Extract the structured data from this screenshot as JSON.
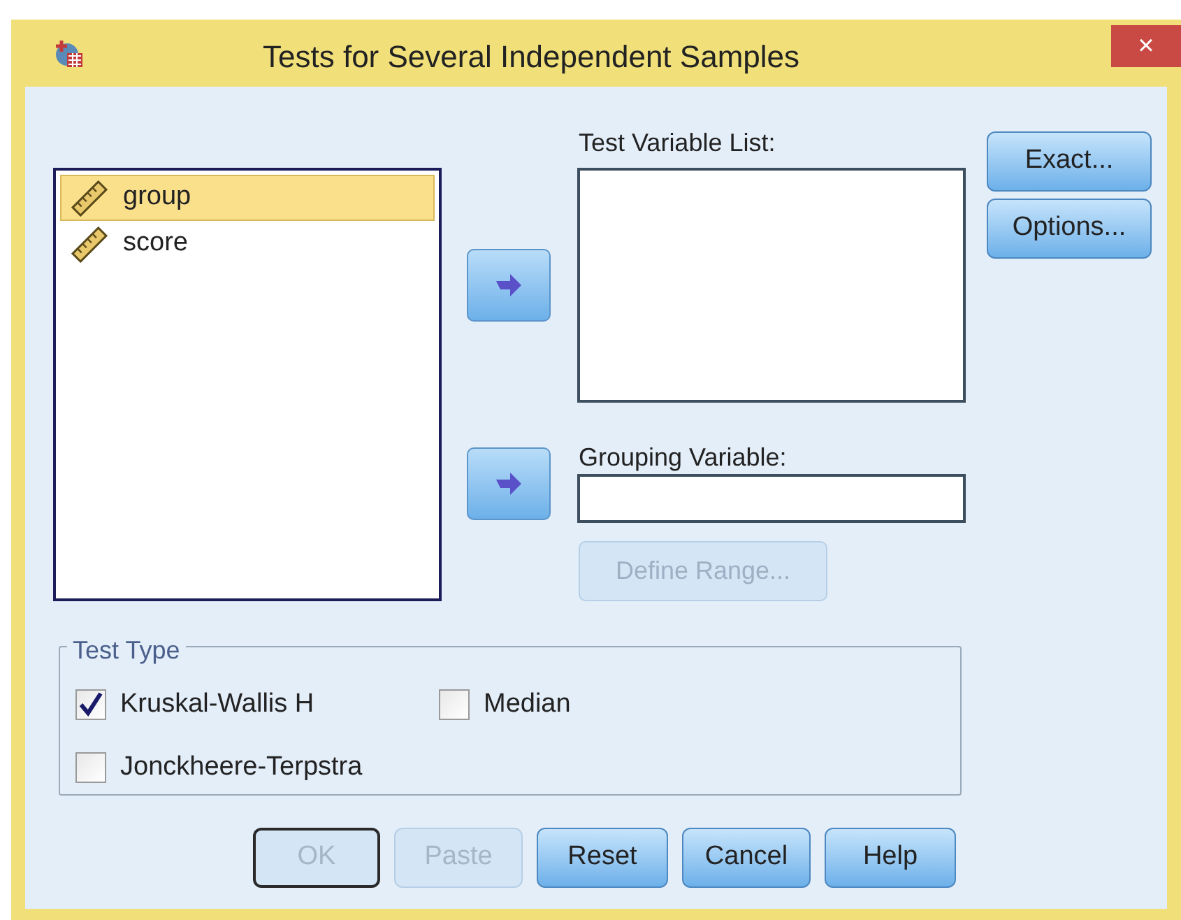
{
  "window": {
    "title": "Tests for Several Independent Samples",
    "close": "×"
  },
  "source_variables": [
    {
      "name": "group",
      "selected": true
    },
    {
      "name": "score",
      "selected": false
    }
  ],
  "test_variable_list": {
    "label": "Test Variable List:"
  },
  "grouping_variable": {
    "label": "Grouping Variable:",
    "define_range": {
      "label": "Define Range...",
      "disabled": true
    }
  },
  "side_buttons": [
    {
      "label": "Exact..."
    },
    {
      "label": "Options..."
    }
  ],
  "test_type": {
    "title": "Test Type",
    "options": [
      {
        "label": "Kruskal-Wallis H",
        "checked": true
      },
      {
        "label": "Median",
        "checked": false
      },
      {
        "label": "Jonckheere-Terpstra",
        "checked": false
      }
    ]
  },
  "buttons": [
    {
      "label": "OK",
      "disabled": true,
      "default": true
    },
    {
      "label": "Paste",
      "disabled": true,
      "default": false
    },
    {
      "label": "Reset",
      "disabled": false,
      "default": false
    },
    {
      "label": "Cancel",
      "disabled": false,
      "default": false
    },
    {
      "label": "Help",
      "disabled": false,
      "default": false
    }
  ]
}
